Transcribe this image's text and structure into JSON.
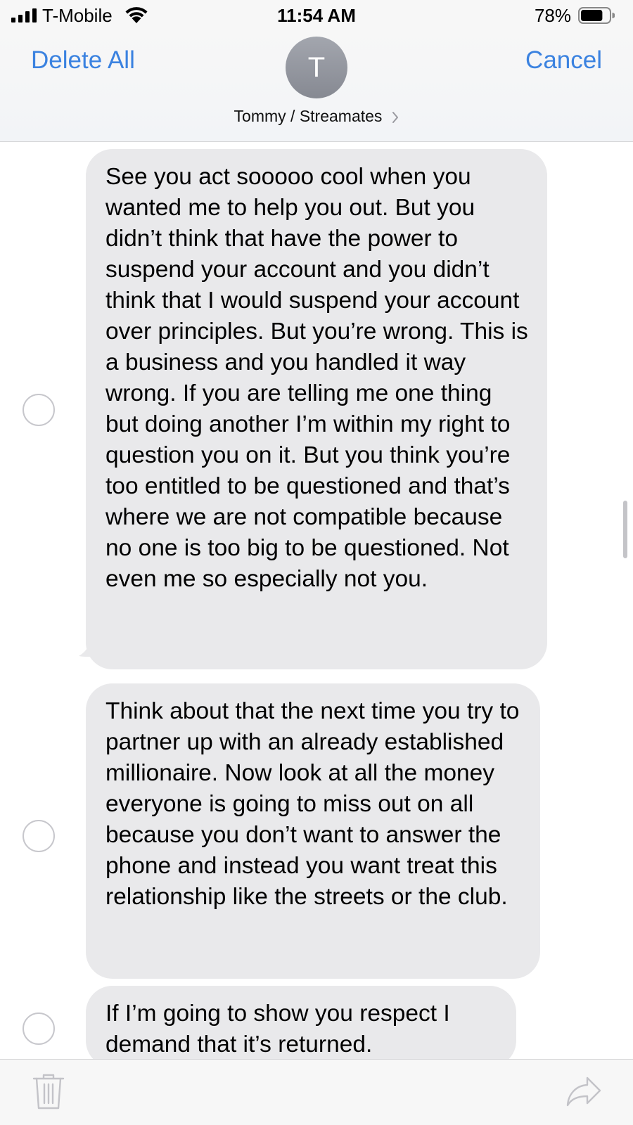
{
  "status_bar": {
    "carrier": "T-Mobile",
    "time": "11:54 AM",
    "battery_percent": "78%",
    "battery_level": 0.78,
    "signal_bars": 4,
    "icons": [
      "signal-icon",
      "wifi-icon",
      "battery-icon"
    ]
  },
  "header": {
    "delete_all_label": "Delete All",
    "cancel_label": "Cancel",
    "avatar_initial": "T",
    "contact_name": "Tommy / Streamates",
    "accent_color": "#3b82e0"
  },
  "messages": [
    {
      "text": "See you act sooooo cool when you wanted me to help you out. But you didn’t think that have the power to suspend your account and you didn’t think that I would suspend your account over principles. But you’re wrong. This is a business and you handled it way wrong. If you are telling me one thing but doing another I’m within my right to question you on it. But you think you’re too entitled to be questioned and that’s where we are not compatible because no one is too big to be questioned. Not even me so especially not you.",
      "selected": false
    },
    {
      "text": "Think about that the next time you try to partner up with an already established millionaire. Now look at all the money everyone is going to miss out on all because you don’t want to answer the phone and instead you want treat this relationship like the streets or the club.",
      "selected": false
    },
    {
      "text": "If I’m going to show you respect I demand that it’s returned.",
      "selected": false
    }
  ],
  "toolbar": {
    "icons": [
      "trash-icon",
      "share-icon"
    ]
  }
}
